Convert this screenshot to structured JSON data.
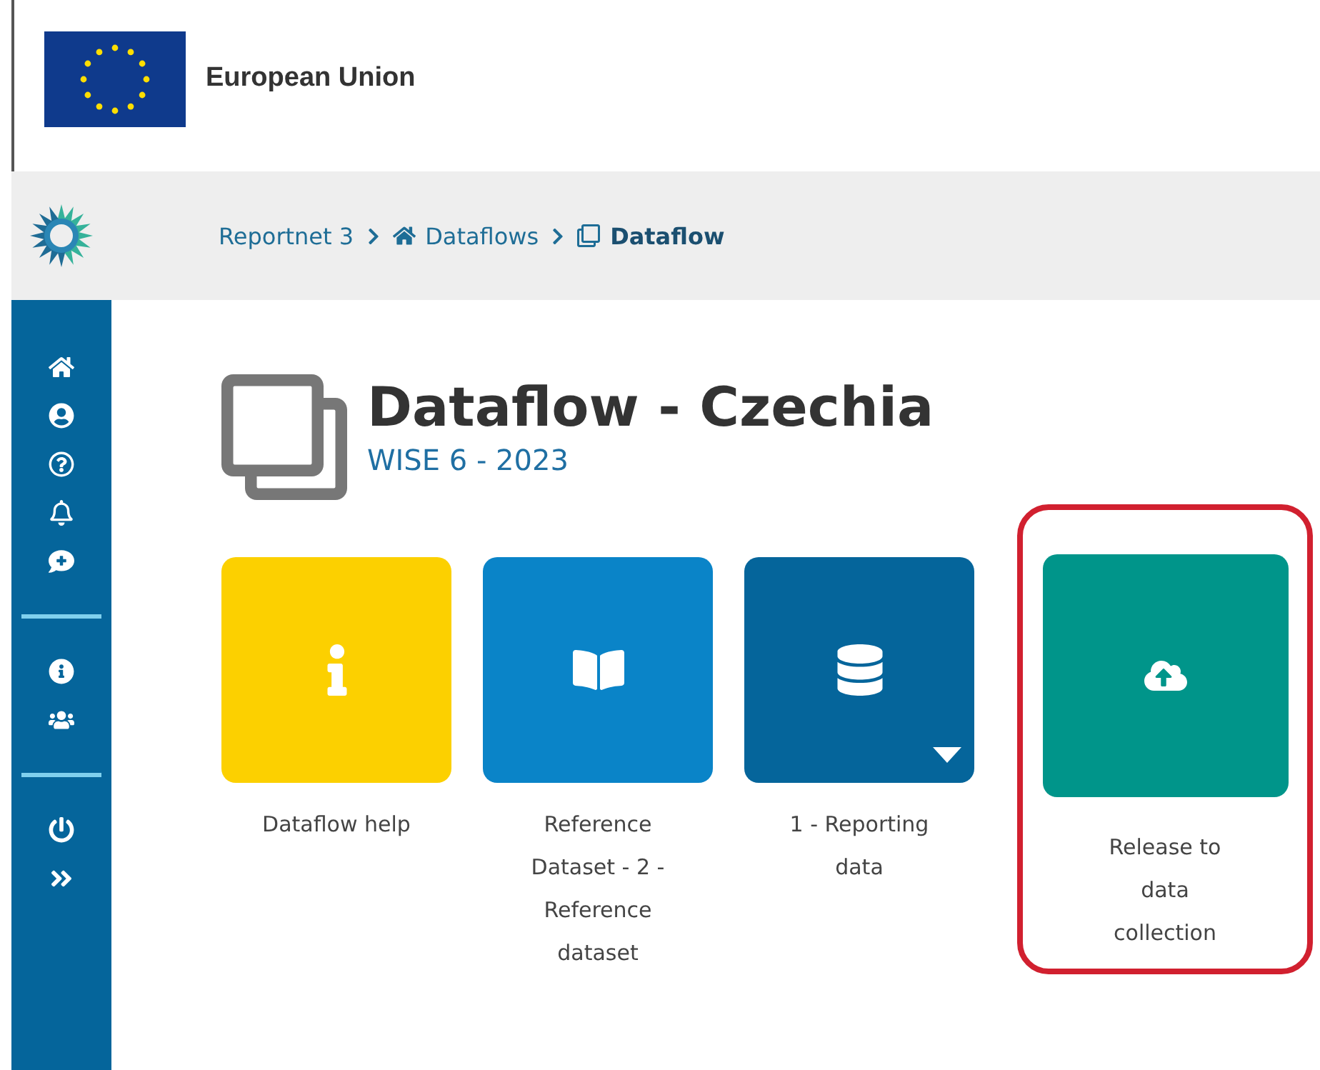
{
  "header": {
    "org_name": "European Union"
  },
  "breadcrumb": [
    {
      "kind": "root",
      "label": "Reportnet 3"
    },
    {
      "kind": "home",
      "label": "Dataflows"
    },
    {
      "kind": "current",
      "label": "Dataflow"
    }
  ],
  "page": {
    "title": "Dataflow - Czechia",
    "subtitle": "WISE 6 - 2023"
  },
  "tiles": [
    {
      "kind": "help",
      "label": "Dataflow help",
      "color": "#fcd000",
      "dropdown": false,
      "highlighted": false
    },
    {
      "kind": "reference",
      "label": "Reference Dataset - 2 - Reference dataset",
      "color": "#0a84c8",
      "dropdown": false,
      "highlighted": false
    },
    {
      "kind": "reporting",
      "label": "1 - Reporting data",
      "color": "#05659b",
      "dropdown": true,
      "highlighted": false
    },
    {
      "kind": "release",
      "label": "Release to data collection",
      "color": "#00958a",
      "dropdown": false,
      "highlighted": true
    }
  ]
}
